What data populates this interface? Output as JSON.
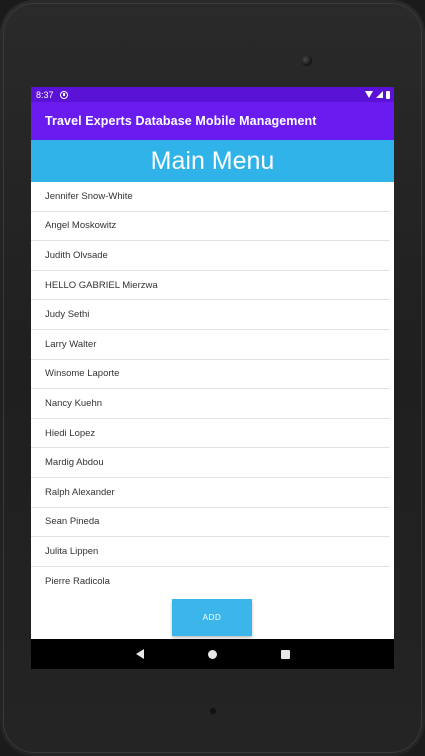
{
  "status_bar": {
    "time": "8:37"
  },
  "app_bar": {
    "title": "Travel Experts Database Mobile Management"
  },
  "header": {
    "title": "Main Menu"
  },
  "agents": [
    "Jennifer Snow-White",
    "Angel Moskowitz",
    "Judith Olvsade",
    "HELLO GABRIEL Mierzwa",
    "Judy Sethi",
    "Larry Walter",
    "Winsome Laporte",
    "Nancy Kuehn",
    "Hiedi Lopez",
    "Mardig Abdou",
    "Ralph Alexander",
    "Sean Pineda",
    "Julita Lippen",
    "Pierre Radicola"
  ],
  "add_button": {
    "label": "ADD"
  },
  "colors": {
    "status_bar": "#5a12d6",
    "app_bar": "#6a1cf0",
    "header": "#2fb3e9",
    "button": "#3cb6ea"
  },
  "icons": {
    "notification": "notification-icon",
    "wifi": "wifi-icon",
    "signal": "signal-icon",
    "battery": "battery-icon",
    "back": "back-icon",
    "home": "home-icon",
    "recents": "recents-icon"
  }
}
